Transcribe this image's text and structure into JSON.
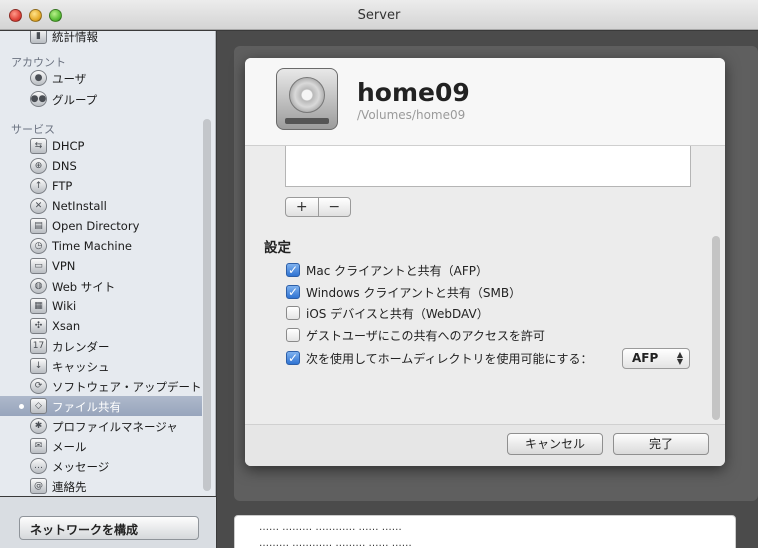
{
  "window": {
    "title": "Server"
  },
  "sidebar": {
    "top_item": "統計情報",
    "sections": [
      {
        "header": "アカウント",
        "items": [
          "ユーザ",
          "グループ"
        ]
      },
      {
        "header": "サービス",
        "items": [
          "DHCP",
          "DNS",
          "FTP",
          "NetInstall",
          "Open Directory",
          "Time Machine",
          "VPN",
          "Web サイト",
          "Wiki",
          "Xsan",
          "カレンダー",
          "キャッシュ",
          "ソフトウェア・アップデート",
          "ファイル共有",
          "プロファイルマネージャ",
          "メール",
          "メッセージ",
          "連絡先"
        ]
      }
    ],
    "selected": "ファイル共有",
    "configure_button": "ネットワークを構成"
  },
  "sheet": {
    "volume_name": "home09",
    "volume_path": "/Volumes/home09",
    "add_button": "+",
    "remove_button": "−",
    "settings_title": "設定",
    "options": [
      {
        "label": "Mac クライアントと共有（AFP）",
        "checked": true
      },
      {
        "label": "Windows クライアントと共有（SMB）",
        "checked": true
      },
      {
        "label": "iOS デバイスと共有（WebDAV）",
        "checked": false
      },
      {
        "label": "ゲストユーザにこの共有へのアクセスを許可",
        "checked": false
      },
      {
        "label": "次を使用してホームディレクトリを使用可能にする：",
        "checked": true
      }
    ],
    "home_protocol": "AFP",
    "cancel_button": "キャンセル",
    "done_button": "完了"
  },
  "background_text": {
    "line1": "…… ……… ………… …… ……",
    "line2": "……… ………… ……… …… ……"
  }
}
